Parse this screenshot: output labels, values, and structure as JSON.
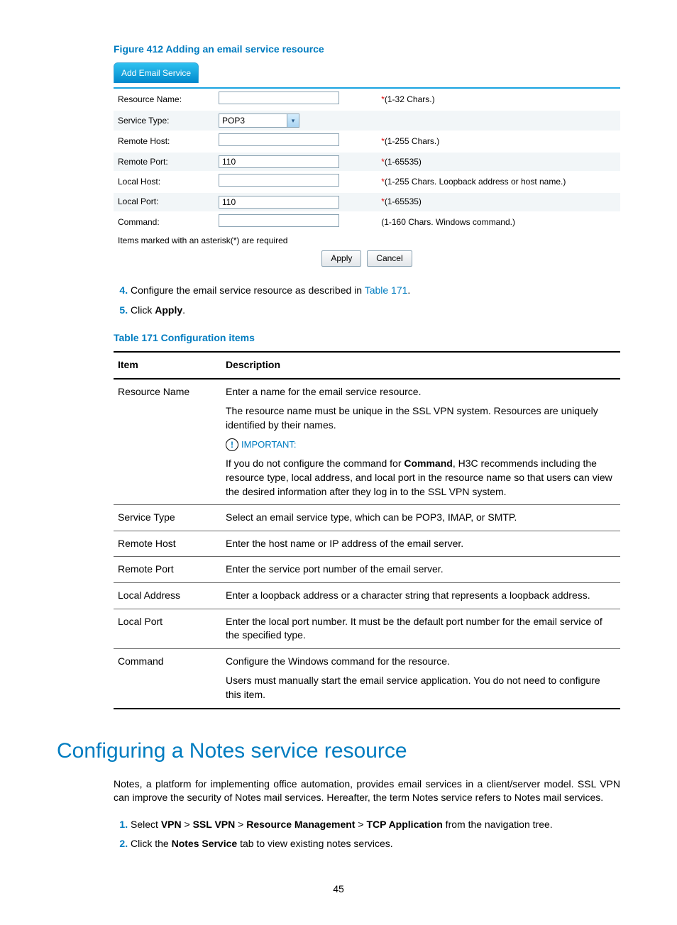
{
  "figure": {
    "title": "Figure 412 Adding an email service resource",
    "tab": "Add Email Service",
    "rows": {
      "resource_name": {
        "label": "Resource Name:",
        "value": "",
        "hint": "(1-32 Chars.)"
      },
      "service_type": {
        "label": "Service Type:",
        "value": "POP3"
      },
      "remote_host": {
        "label": "Remote Host:",
        "value": "",
        "hint": "(1-255 Chars.)"
      },
      "remote_port": {
        "label": "Remote Port:",
        "value": "110",
        "hint": "(1-65535)"
      },
      "local_host": {
        "label": "Local Host:",
        "value": "",
        "hint": "(1-255 Chars. Loopback address or host name.)"
      },
      "local_port": {
        "label": "Local Port:",
        "value": "110",
        "hint": "(1-65535)"
      },
      "command": {
        "label": "Command:",
        "value": "",
        "hint": "(1-160 Chars. Windows command.)"
      }
    },
    "note": "Items marked with an asterisk(*) are required",
    "buttons": {
      "apply": "Apply",
      "cancel": "Cancel"
    }
  },
  "steps_a": {
    "s4_pre": "Configure the email service resource as described in ",
    "s4_link": "Table 171",
    "s4_post": ".",
    "s5_pre": "Click ",
    "s5_bold": "Apply",
    "s5_post": "."
  },
  "table": {
    "title": "Table 171 Configuration items",
    "headers": {
      "item": "Item",
      "desc": "Description"
    },
    "resource_name": {
      "item": "Resource Name",
      "p1": "Enter a name for the email service resource.",
      "p2": "The resource name must be unique in the SSL VPN system. Resources are uniquely identified by their names.",
      "important": "IMPORTANT:",
      "p3a": "If you do not configure the command for ",
      "p3b": "Command",
      "p3c": ", H3C recommends including the resource type, local address, and local port in the resource name so that users can view the desired information after they log in to the SSL VPN system."
    },
    "service_type": {
      "item": "Service Type",
      "p1": "Select an email service type, which can be POP3, IMAP, or SMTP."
    },
    "remote_host": {
      "item": "Remote Host",
      "p1": "Enter the host name or IP address of the email server."
    },
    "remote_port": {
      "item": "Remote Port",
      "p1": "Enter the service port number of the email server."
    },
    "local_address": {
      "item": "Local Address",
      "p1": "Enter a loopback address or a character string that represents a loopback address."
    },
    "local_port": {
      "item": "Local Port",
      "p1": "Enter the local port number. It must be the default port number for the email service of the specified type."
    },
    "command": {
      "item": "Command",
      "p1": "Configure the Windows command for the resource.",
      "p2": "Users must manually start the email service application. You do not need to configure this item."
    }
  },
  "section": {
    "heading": "Configuring a Notes service resource",
    "intro": "Notes, a platform for implementing office automation, provides email services in a client/server model. SSL VPN can improve the security of Notes mail services. Hereafter, the term Notes service refers to Notes mail services.",
    "step1": {
      "pre": "Select ",
      "b1": "VPN",
      "gt1": " > ",
      "b2": "SSL VPN",
      "gt2": " > ",
      "b3": "Resource Management",
      "gt3": " > ",
      "b4": "TCP Application",
      "post": " from the navigation tree."
    },
    "step2": {
      "pre": "Click the ",
      "b1": "Notes Service",
      "post": " tab to view existing notes services."
    }
  },
  "page_number": "45"
}
